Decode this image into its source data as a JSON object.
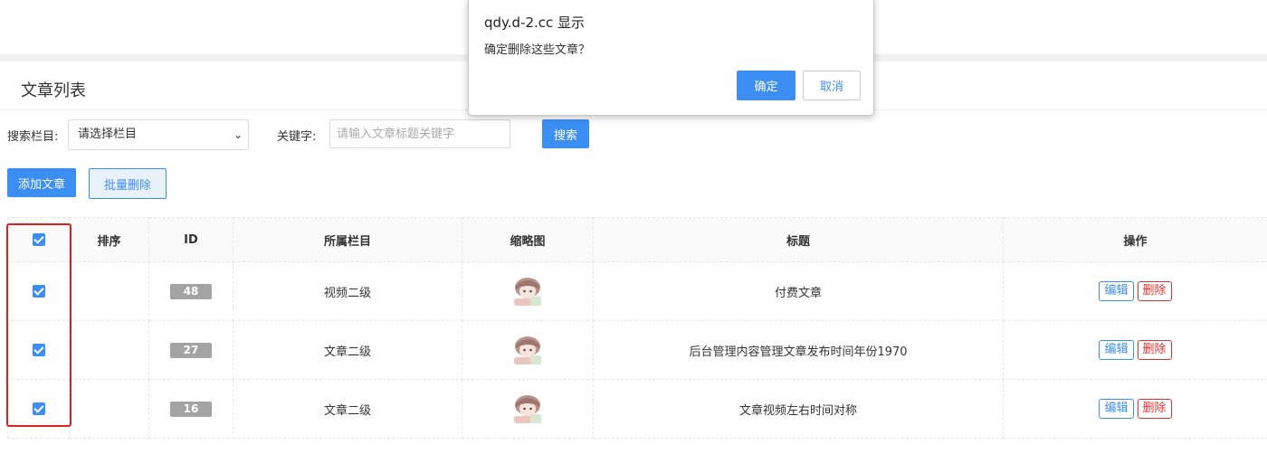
{
  "dialog": {
    "title": "qdy.d-2.cc 显示",
    "message": "确定删除这些文章？",
    "ok_label": "确定",
    "cancel_label": "取消"
  },
  "page": {
    "section_title": "文章列表"
  },
  "search": {
    "category_label": "搜索栏目:",
    "category_value": "请选择栏目",
    "keyword_label": "关键字:",
    "keyword_placeholder": "请输入文章标题关键字",
    "search_label": "搜索"
  },
  "toolbar": {
    "add_label": "添加文章",
    "batch_delete_label": "批量删除"
  },
  "table": {
    "headers": [
      "",
      "排序",
      "ID",
      "所属栏目",
      "缩略图",
      "标题",
      "操作"
    ],
    "rows": [
      {
        "id": "48",
        "category": "视频二级",
        "title": "付费文章",
        "checked": true
      },
      {
        "id": "27",
        "category": "文章二级",
        "title": "后台管理内容管理文章发布时间年份1970",
        "checked": true
      },
      {
        "id": "16",
        "category": "文章二级",
        "title": "文章视频左右时间对称",
        "checked": true
      }
    ],
    "edit_label": "编辑",
    "delete_label": "删除"
  },
  "colors": {
    "primary": "#3c8ef3",
    "danger": "#dd3333",
    "highlight": "#e02020"
  }
}
